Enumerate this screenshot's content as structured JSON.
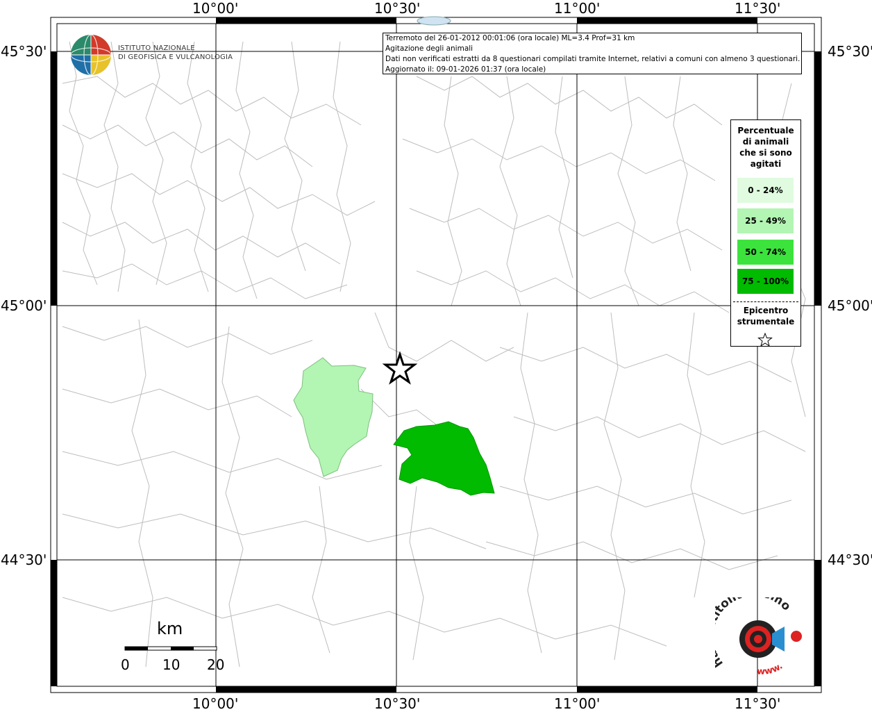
{
  "axes": {
    "top_labels": [
      "10°00'",
      "10°30'",
      "11°00'",
      "11°30'"
    ],
    "bottom_labels": [
      "10°00'",
      "10°30'",
      "11°00'",
      "11°30'"
    ],
    "left_labels": [
      "45°30'",
      "45°00'",
      "44°30'"
    ],
    "right_labels": [
      "45°30'",
      "45°00'",
      "44°30'"
    ]
  },
  "info": {
    "line1": "Terremoto del 26-01-2012 00:01:06 (ora locale) ML=3.4 Prof=31 km",
    "line2": "Agitazione degli animali",
    "line3": "Dati non verificati estratti da 8 questionari compilati tramite Internet, relativi a comuni con almeno 3 questionari.",
    "line4": "Aggiornato il: 09-01-2026 01:37 (ora locale)"
  },
  "logo": {
    "line1": "ISTITUTO NAZIONALE",
    "line2": "DI GEOFISICA E VULCANOLOGIA"
  },
  "legend": {
    "title1": "Percentuale",
    "title2": "di animali",
    "title3": "che si sono",
    "title4": "agitati",
    "classes": [
      {
        "label": "0 - 24%",
        "color": "#e0fbe0"
      },
      {
        "label": "25 - 49%",
        "color": "#b3f5b3"
      },
      {
        "label": "50 - 74%",
        "color": "#3ce33c"
      },
      {
        "label": "75 - 100%",
        "color": "#00bb00"
      }
    ],
    "epi1": "Epicentro",
    "epi2": "strumentale"
  },
  "scale": {
    "unit": "km",
    "labels": [
      "0",
      "10",
      "20"
    ]
  },
  "watermark": {
    "text": "haisentitoilterremoto.it",
    "www": "www."
  },
  "colors": {
    "grid": "#000000",
    "boundaries": "#bdbdbd",
    "region_light": "#b3f5b3",
    "region_dark": "#00bb00",
    "epicenter_star": "#000000"
  }
}
